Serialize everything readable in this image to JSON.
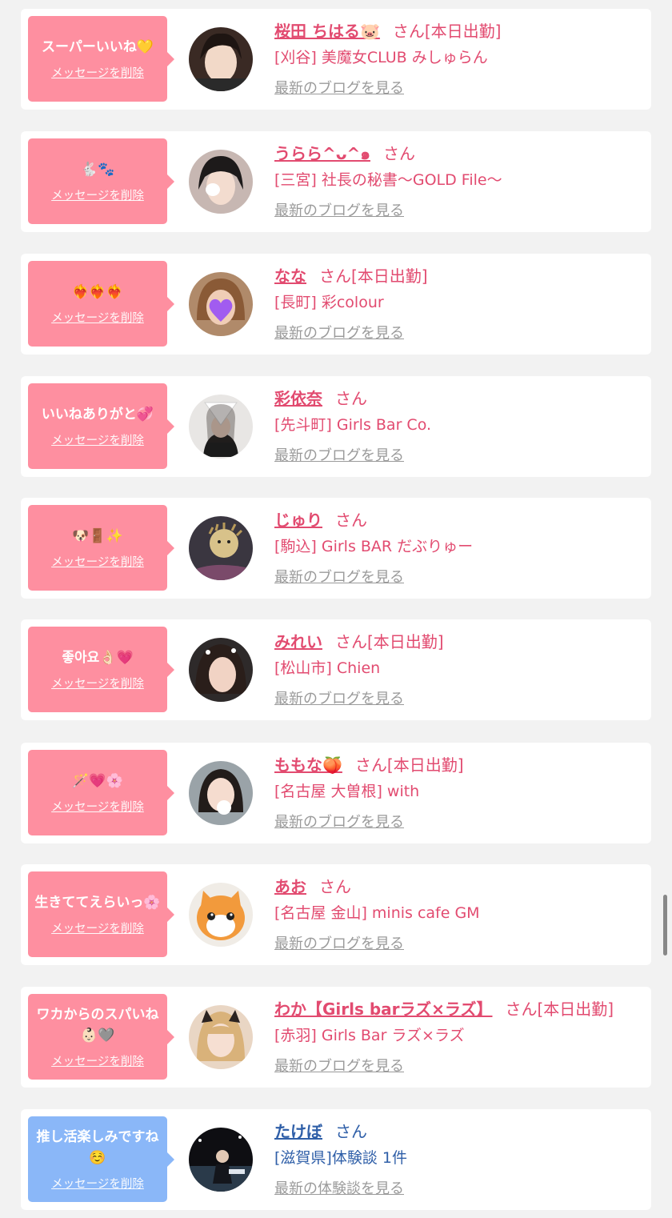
{
  "common": {
    "delete_label": "メッセージを削除",
    "san": "さん"
  },
  "messages": [
    {
      "message": "スーパーいいね💛",
      "name": "桜田 ちはる🐷",
      "status": "[本日出勤]",
      "shop": "[刈谷] 美魔女CLUB みしゅらん",
      "link": "最新のブログを見る",
      "theme": "pink"
    },
    {
      "message": "🐇🐾",
      "name": "うらら^ᴗ^๑",
      "status": "",
      "shop": "[三宮] 社長の秘書〜GOLD File〜",
      "link": "最新のブログを見る",
      "theme": "pink"
    },
    {
      "message": "❤️‍🔥❤️‍🔥❤️‍🔥",
      "name": "なな",
      "status": "[本日出勤]",
      "shop": "[長町] 彩colour",
      "link": "最新のブログを見る",
      "theme": "pink"
    },
    {
      "message": "いいねありがと💞",
      "name": "彩依奈",
      "status": "",
      "shop": "[先斗町] Girls Bar Co.",
      "link": "最新のブログを見る",
      "theme": "pink"
    },
    {
      "message": "🐶🚪✨",
      "name": "じゅり",
      "status": "",
      "shop": "[駒込] Girls BAR だぶりゅー",
      "link": "最新のブログを見る",
      "theme": "pink"
    },
    {
      "message": "좋아요👌🏻💗",
      "name": "みれい",
      "status": "[本日出勤]",
      "shop": "[松山市] Chien",
      "link": "最新のブログを見る",
      "theme": "pink"
    },
    {
      "message": "🪄💗🌸",
      "name": "ももな🍑",
      "status": "[本日出勤]",
      "shop": "[名古屋 大曽根] with",
      "link": "最新のブログを見る",
      "theme": "pink"
    },
    {
      "message": "生きててえらいっ🌸",
      "name": "あお",
      "status": "",
      "shop": "[名古屋 金山] minis cafe GM",
      "link": "最新のブログを見る",
      "theme": "pink"
    },
    {
      "message": "ワカからのスパいね👶🏻🩶",
      "name": "わか【Girls barラズ×ラズ】",
      "status": "[本日出勤]",
      "shop": "[赤羽] Girls Bar ラズ×ラズ",
      "link": "最新のブログを見る",
      "theme": "pink"
    },
    {
      "message": "推し活楽しみですね☺️",
      "name": "たけぼ",
      "status": "",
      "shop": "[滋賀県]体験談 1件",
      "link": "最新の体験談を見る",
      "theme": "blue"
    }
  ],
  "colors": {
    "pink_bubble": "#fe8fa0",
    "blue_bubble": "#8ab7f8",
    "pink_text": "#e24b70",
    "blue_text": "#2f5fa8",
    "link_gray": "#9a9a9a",
    "background": "#f2f2f2"
  }
}
